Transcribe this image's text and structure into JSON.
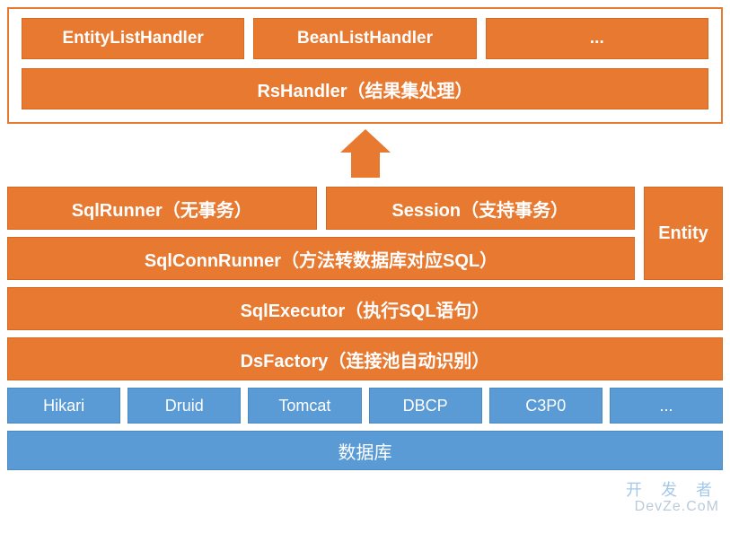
{
  "handlers": {
    "items": [
      "EntityListHandler",
      "BeanListHandler",
      "..."
    ],
    "main": "RsHandler（结果集处理）"
  },
  "runners": {
    "sqlRunner": "SqlRunner（无事务）",
    "session": "Session（支持事务）",
    "sqlConnRunner": "SqlConnRunner（方法转数据库对应SQL）",
    "entity": "Entity"
  },
  "executor": "SqlExecutor（执行SQL语句）",
  "dsFactory": "DsFactory（连接池自动识别）",
  "pools": [
    "Hikari",
    "Druid",
    "Tomcat",
    "DBCP",
    "C3P0",
    "..."
  ],
  "database": "数据库",
  "watermark": {
    "line1": "开 发 者",
    "line2": "DevZe.CoM"
  }
}
